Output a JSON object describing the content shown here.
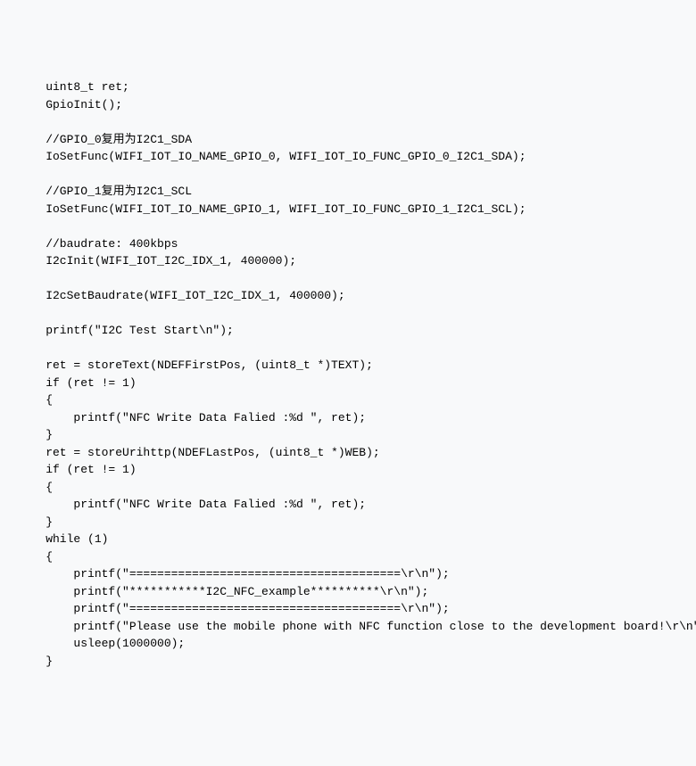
{
  "lines": [
    {
      "indent": 1,
      "text": "uint8_t ret;",
      "class": ""
    },
    {
      "indent": 1,
      "text": "GpioInit();",
      "class": ""
    },
    {
      "indent": 1,
      "text": "",
      "class": ""
    },
    {
      "indent": 1,
      "text": "//GPIO_0复用为I2C1_SDA",
      "class": "comment"
    },
    {
      "indent": 1,
      "text": "IoSetFunc(WIFI_IOT_IO_NAME_GPIO_0, WIFI_IOT_IO_FUNC_GPIO_0_I2C1_SDA);",
      "class": ""
    },
    {
      "indent": 1,
      "text": "",
      "class": ""
    },
    {
      "indent": 1,
      "text": "//GPIO_1复用为I2C1_SCL",
      "class": "comment"
    },
    {
      "indent": 1,
      "text": "IoSetFunc(WIFI_IOT_IO_NAME_GPIO_1, WIFI_IOT_IO_FUNC_GPIO_1_I2C1_SCL);",
      "class": ""
    },
    {
      "indent": 1,
      "text": "",
      "class": ""
    },
    {
      "indent": 1,
      "text": "//baudrate: 400kbps",
      "class": "comment"
    },
    {
      "indent": 1,
      "text": "I2cInit(WIFI_IOT_I2C_IDX_1, 400000);",
      "class": ""
    },
    {
      "indent": 1,
      "text": "",
      "class": ""
    },
    {
      "indent": 1,
      "text": "I2cSetBaudrate(WIFI_IOT_I2C_IDX_1, 400000);",
      "class": ""
    },
    {
      "indent": 1,
      "text": "",
      "class": ""
    },
    {
      "indent": 1,
      "text": "printf(\"I2C Test Start\\n\");",
      "class": ""
    },
    {
      "indent": 1,
      "text": "",
      "class": ""
    },
    {
      "indent": 1,
      "text": "ret = storeText(NDEFFirstPos, (uint8_t *)TEXT);",
      "class": ""
    },
    {
      "indent": 1,
      "text": "if (ret != 1)",
      "class": ""
    },
    {
      "indent": 1,
      "text": "{",
      "class": ""
    },
    {
      "indent": 2,
      "text": "printf(\"NFC Write Data Falied :%d \", ret);",
      "class": ""
    },
    {
      "indent": 1,
      "text": "}",
      "class": ""
    },
    {
      "indent": 1,
      "text": "ret = storeUrihttp(NDEFLastPos, (uint8_t *)WEB);",
      "class": ""
    },
    {
      "indent": 1,
      "text": "if (ret != 1)",
      "class": ""
    },
    {
      "indent": 1,
      "text": "{",
      "class": ""
    },
    {
      "indent": 2,
      "text": "printf(\"NFC Write Data Falied :%d \", ret);",
      "class": ""
    },
    {
      "indent": 1,
      "text": "}",
      "class": ""
    },
    {
      "indent": 1,
      "text": "while (1)",
      "class": ""
    },
    {
      "indent": 1,
      "text": "{",
      "class": ""
    },
    {
      "indent": 2,
      "text": "printf(\"=======================================\\r\\n\");",
      "class": ""
    },
    {
      "indent": 2,
      "text": "printf(\"***********I2C_NFC_example**********\\r\\n\");",
      "class": ""
    },
    {
      "indent": 2,
      "text": "printf(\"=======================================\\r\\n\");",
      "class": ""
    },
    {
      "indent": 2,
      "text": "printf(\"Please use the mobile phone with NFC function close to the development board!\\r\\n\");",
      "class": ""
    },
    {
      "indent": 2,
      "text": "usleep(1000000);",
      "class": ""
    },
    {
      "indent": 1,
      "text": "}",
      "class": ""
    }
  ]
}
